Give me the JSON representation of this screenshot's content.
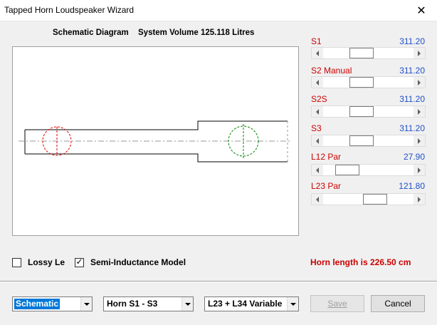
{
  "window": {
    "title": "Tapped Horn Loudspeaker Wizard",
    "close_glyph": "✕"
  },
  "header": {
    "diagram_title": "Schematic Diagram",
    "system_volume": "System Volume 125.118 Litres"
  },
  "params": [
    {
      "label": "S1",
      "value": "311.20",
      "slider_position": 0.4
    },
    {
      "label": "S2  Manual",
      "value": "311.20",
      "slider_position": 0.4
    },
    {
      "label": "S2S",
      "value": "311.20",
      "slider_position": 0.4
    },
    {
      "label": "S3",
      "value": "311.20",
      "slider_position": 0.4
    },
    {
      "label": "L12  Par",
      "value": "27.90",
      "slider_position": 0.18
    },
    {
      "label": "L23  Par",
      "value": "121.80",
      "slider_position": 0.6
    }
  ],
  "options": {
    "lossy_le": {
      "label": "Lossy Le",
      "checked": false
    },
    "semi_inductance": {
      "label": "Semi-Inductance Model",
      "checked": true
    }
  },
  "status": {
    "horn_length": "Horn length is 226.50 cm"
  },
  "footer": {
    "view_select": "Schematic",
    "horn_select": "Horn S1 - S3",
    "variable_select": "L23 + L34 Variable",
    "save_label": "Save",
    "cancel_label": "Cancel"
  },
  "colors": {
    "label_red": "#cc0000",
    "value_blue": "#1f4fc8",
    "driver_red": "#e00000",
    "driver_green": "#008000",
    "selection_blue": "#0078d7"
  }
}
